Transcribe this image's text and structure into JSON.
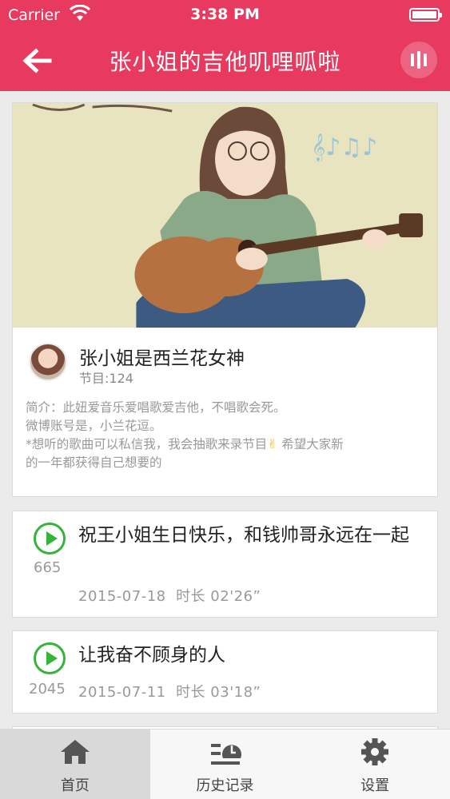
{
  "status_bar": {
    "carrier": "Carrier",
    "time": "3:38 PM"
  },
  "nav": {
    "title": "张小姐的吉他叽哩呱啦",
    "back_icon": "arrow-left-icon",
    "player_icon": "equalizer-icon"
  },
  "colors": {
    "accent": "#e8395f",
    "play_green": "#35b33a"
  },
  "profile": {
    "cover_icon": "girl-playing-guitar-illustration",
    "name": "张小姐是西兰花女神",
    "episodes_label": "节目:124",
    "desc_line1": "简介：此妞爱音乐爱唱歌爱吉他，不唱歌会死。",
    "desc_line2": "微博账号是，小兰花逗。",
    "desc_line3_a": "*想听的歌曲可以私信我，我会抽歌来录节目",
    "desc_emoji": "✌",
    "desc_line3_b": "希望大家新",
    "desc_line4": "的一年都获得自己想要的"
  },
  "episodes": [
    {
      "title": "祝王小姐生日快乐，和钱帅哥永远在一起",
      "plays": "665",
      "date": "2015-07-18",
      "duration": "时长 02'26”"
    },
    {
      "title": "让我奋不顾身的人",
      "plays": "2045",
      "date": "2015-07-11",
      "duration": "时长 03'18”"
    }
  ],
  "tabs": [
    {
      "label": "首页",
      "icon": "home-icon",
      "active": true
    },
    {
      "label": "历史记录",
      "icon": "history-icon",
      "active": false
    },
    {
      "label": "设置",
      "icon": "gear-icon",
      "active": false
    }
  ]
}
